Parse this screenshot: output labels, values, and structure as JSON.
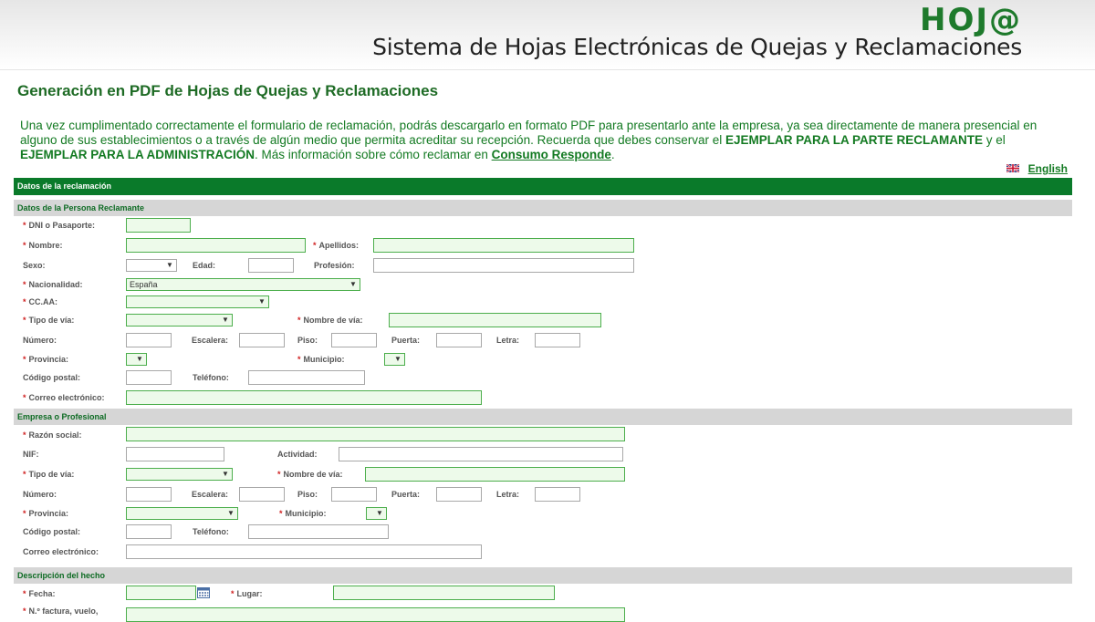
{
  "header": {
    "logo": "HOJ@",
    "subtitle": "Sistema de Hojas Electrónicas de Quejas y Reclamaciones"
  },
  "page_title": "Generación en PDF de Hojas de Quejas y Reclamaciones",
  "intro": {
    "part1": "Una vez cumplimentado correctamente el formulario de reclamación, podrás descargarlo en formato PDF para presentarlo ante la empresa, ya sea directamente de manera presencial en alguno de sus establecimientos o a través de algún medio que permita acreditar su recepción. Recuerda que debes conservar el ",
    "bold1": "EJEMPLAR PARA LA PARTE RECLAMANTE",
    "part2": " y el ",
    "bold2": "EJEMPLAR PARA LA ADMINISTRACIÓN",
    "part3": ". Más información sobre cómo reclamar en ",
    "link": "Consumo Responde",
    "part4": "."
  },
  "language_link": "English",
  "colors": {
    "accent": "#0a7a2a",
    "title": "#1e6b25",
    "required": "#d02020",
    "field_bg": "#edfaea"
  },
  "form": {
    "header": "Datos de la reclamación",
    "sections": {
      "claimant": "Datos de la Persona Reclamante",
      "company": "Empresa o Profesional",
      "facts": "Descripción del hecho"
    },
    "claimant": {
      "dni": "DNI o Pasaporte:",
      "nombre": "Nombre:",
      "apellidos": "Apellidos:",
      "sexo": "Sexo:",
      "edad": "Edad:",
      "profesion": "Profesión:",
      "nacionalidad": "Nacionalidad:",
      "nacionalidad_value": "España",
      "ccaa": "CC.AA:",
      "tipo_via": "Tipo de vía:",
      "nombre_via": "Nombre de vía:",
      "numero": "Número:",
      "escalera": "Escalera:",
      "piso": "Piso:",
      "puerta": "Puerta:",
      "letra": "Letra:",
      "provincia": "Provincia:",
      "municipio": "Municipio:",
      "codigo_postal": "Código postal:",
      "telefono": "Teléfono:",
      "correo": "Correo electrónico:"
    },
    "company": {
      "razon_social": "Razón social:",
      "nif": "NIF:",
      "actividad": "Actividad:",
      "tipo_via": "Tipo de vía:",
      "nombre_via": "Nombre de vía:",
      "numero": "Número:",
      "escalera": "Escalera:",
      "piso": "Piso:",
      "puerta": "Puerta:",
      "letra": "Letra:",
      "provincia": "Provincia:",
      "municipio": "Municipio:",
      "codigo_postal": "Código postal:",
      "telefono": "Teléfono:",
      "correo": "Correo electrónico:"
    },
    "facts": {
      "fecha": "Fecha:",
      "lugar": "Lugar:",
      "factura": "N.º factura, vuelo,"
    },
    "required_mark": "*",
    "select_arrow": "▼"
  }
}
